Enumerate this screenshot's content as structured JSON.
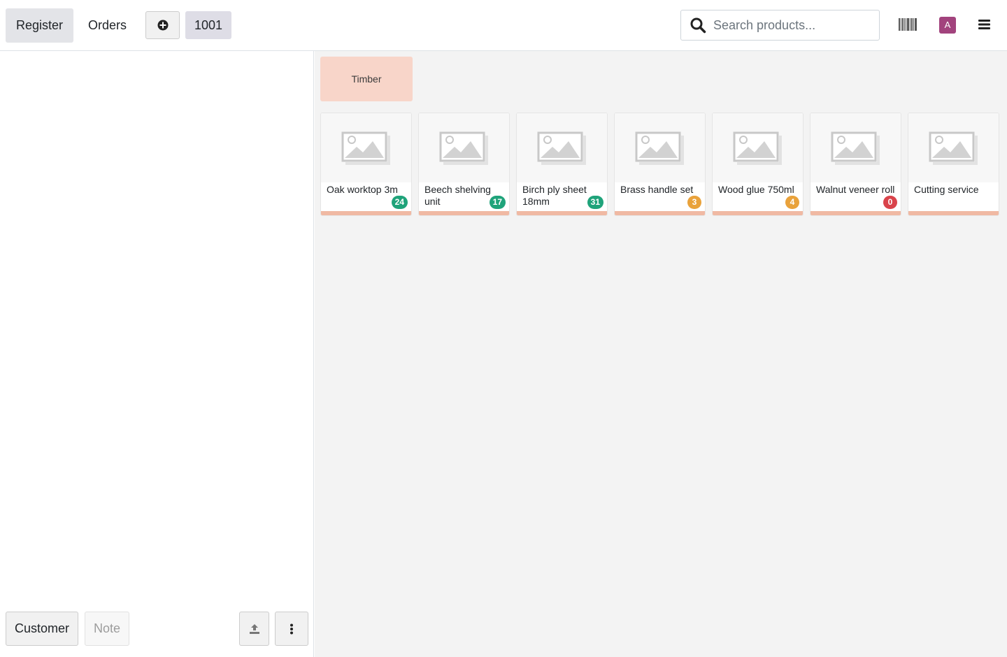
{
  "header": {
    "register_label": "Register",
    "orders_label": "Orders",
    "order_number": "1001",
    "search_placeholder": "Search products...",
    "avatar_letter": "A"
  },
  "categories": [
    {
      "label": "Timber"
    }
  ],
  "products": [
    {
      "name": "Oak worktop 3m",
      "stock": "24",
      "stock_color": "#1fa37a"
    },
    {
      "name": "Beech shelving unit",
      "stock": "17",
      "stock_color": "#1fa37a"
    },
    {
      "name": "Birch ply sheet 18mm",
      "stock": "31",
      "stock_color": "#1fa37a"
    },
    {
      "name": "Brass handle set",
      "stock": "3",
      "stock_color": "#e9a23b"
    },
    {
      "name": "Wood glue 750ml",
      "stock": "4",
      "stock_color": "#e9a23b"
    },
    {
      "name": "Walnut veneer roll",
      "stock": "0",
      "stock_color": "#d9434b"
    },
    {
      "name": "Cutting service"
    }
  ],
  "footer": {
    "customer_label": "Customer",
    "note_label": "Note"
  },
  "colors": {
    "accent_avatar": "#a2437d",
    "category_bg": "#f8d5c9",
    "stripe": "#f0b9a3"
  }
}
